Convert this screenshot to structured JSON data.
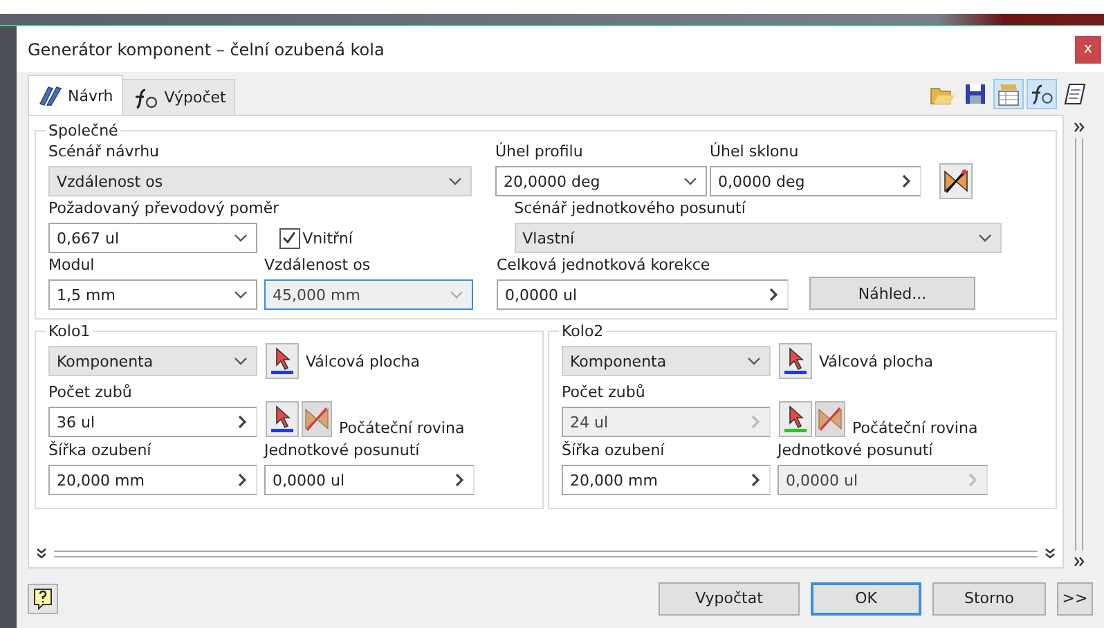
{
  "window": {
    "title": "Generátor komponent – čelní ozubená kola",
    "close_label": "x"
  },
  "tabs": [
    {
      "label": "Návrh",
      "kind": "design",
      "selected": true
    },
    {
      "label": "Výpočet",
      "kind": "calc",
      "selected": false
    }
  ],
  "toolbar": [
    {
      "kind": "open",
      "pressed": false
    },
    {
      "kind": "save",
      "pressed": false
    },
    {
      "kind": "options",
      "pressed": true
    },
    {
      "kind": "formula",
      "pressed": true
    },
    {
      "kind": "notes",
      "pressed": false
    }
  ],
  "common": {
    "title": "Společné",
    "design_scenario": {
      "label": "Scénář návrhu",
      "value": "Vzdálenost os",
      "kind": "select",
      "disabled": false,
      "focused": false
    },
    "pressure_angle": {
      "label": "Úhel profilu",
      "value": "20,0000 deg",
      "kind": "combo",
      "disabled": false,
      "focused": false
    },
    "helix_angle": {
      "label": "Úhel sklonu",
      "value": "0,0000 deg",
      "kind": "spin",
      "disabled": false,
      "focused": false
    },
    "ratio": {
      "label": "Požadovaný převodový poměr",
      "value": "0,667 ul",
      "kind": "combo",
      "disabled": false,
      "focused": false
    },
    "internal": {
      "label": "Vnitřní",
      "checked": true
    },
    "shift_scenario": {
      "label": "Scénář jednotkového posunutí",
      "value": "Vlastní",
      "kind": "select",
      "disabled": false,
      "focused": false
    },
    "module": {
      "label": "Modul",
      "value": "1,5 mm",
      "kind": "combo",
      "disabled": false,
      "focused": false
    },
    "center_distance": {
      "label": "Vzdálenost os",
      "value": "45,000 mm",
      "kind": "combo",
      "disabled": true,
      "focused": true
    },
    "total_correction": {
      "label": "Celková jednotková korekce",
      "value": "0,0000 ul",
      "kind": "spin",
      "disabled": false,
      "focused": false
    },
    "preview_button": "Náhled..."
  },
  "gears": [
    {
      "title": "Kolo1",
      "type": {
        "value": "Komponenta",
        "kind": "select",
        "disabled": false,
        "focused": false
      },
      "surface": {
        "label": "Válcová plocha",
        "color": "#1e3ce6"
      },
      "teeth": {
        "label": "Počet zubů",
        "value": "36 ul",
        "kind": "spin",
        "disabled": false,
        "focused": false
      },
      "plane": {
        "label": "Počáteční rovina",
        "color": "#1e3ce6"
      },
      "width": {
        "label": "Šířka ozubení",
        "value": "20,000 mm",
        "kind": "spin",
        "disabled": false,
        "focused": false
      },
      "shift": {
        "label": "Jednotkové posunutí",
        "value": "0,0000 ul",
        "kind": "spin",
        "disabled": false,
        "focused": false
      }
    },
    {
      "title": "Kolo2",
      "type": {
        "value": "Komponenta",
        "kind": "select",
        "disabled": false,
        "focused": false
      },
      "surface": {
        "label": "Válcová plocha",
        "color": "#1e3ce6"
      },
      "teeth": {
        "label": "Počet zubů",
        "value": "24 ul",
        "kind": "spin",
        "disabled": true,
        "focused": false
      },
      "plane": {
        "label": "Počáteční rovina",
        "color": "#22cc22"
      },
      "width": {
        "label": "Šířka ozubení",
        "value": "20,000 mm",
        "kind": "spin",
        "disabled": false,
        "focused": false
      },
      "shift": {
        "label": "Jednotkové posunutí",
        "value": "0,0000 ul",
        "kind": "spin",
        "disabled": true,
        "focused": false
      }
    }
  ],
  "footer_buttons": [
    {
      "label": "Vypočtat",
      "focused": false
    },
    {
      "label": "OK",
      "focused": true
    },
    {
      "label": "Storno",
      "focused": false
    },
    {
      "label": ">>",
      "focused": false
    }
  ]
}
